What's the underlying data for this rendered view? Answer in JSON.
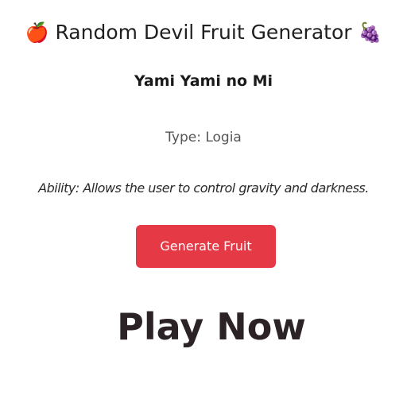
{
  "header": {
    "emoji_left": "🍎",
    "title": "Random Devil Fruit Generator",
    "emoji_right": "🍇"
  },
  "fruit": {
    "name": "Yami Yami no Mi",
    "type": "Type: Logia",
    "ability": "Ability: Allows the user to control gravity and darkness."
  },
  "actions": {
    "generate_label": "Generate Fruit"
  },
  "promo": {
    "play_now": "Play Now"
  },
  "colors": {
    "button_bg": "#e63946",
    "button_text": "#ffffff",
    "promo_text": "#2b2325"
  }
}
